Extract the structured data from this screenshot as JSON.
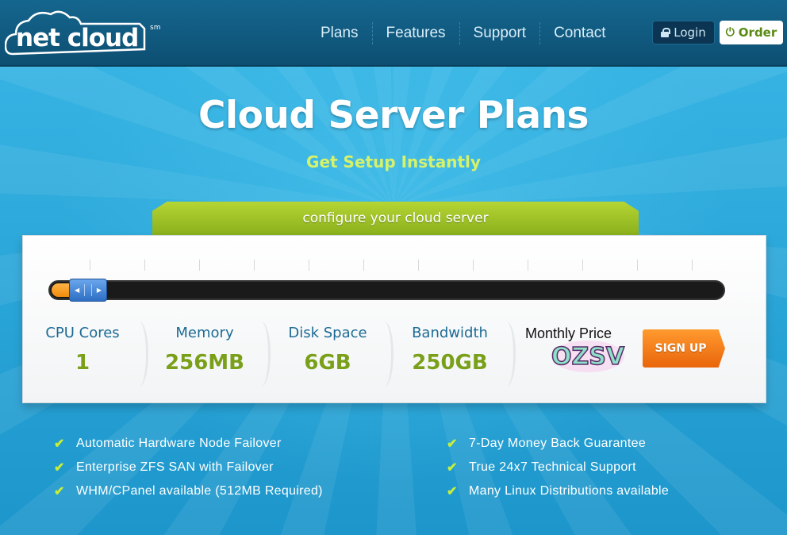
{
  "brand": {
    "logo_text": "net cloud",
    "logo_sm": "sm"
  },
  "nav": {
    "items": [
      "Plans",
      "Features",
      "Support",
      "Contact"
    ]
  },
  "header": {
    "login_label": "Login",
    "order_label": "Order"
  },
  "hero": {
    "title": "Cloud Server Plans",
    "subtitle": "Get Setup Instantly"
  },
  "configurator": {
    "tab_label": "configure your cloud server",
    "slider": {
      "level": 1,
      "steps": 12
    },
    "specs": [
      {
        "label": "CPU Cores",
        "value": "1"
      },
      {
        "label": "Memory",
        "value": "256MB"
      },
      {
        "label": "Disk Space",
        "value": "6GB"
      },
      {
        "label": "Bandwidth",
        "value": "250GB"
      }
    ],
    "price_label": "Monthly Price",
    "price_badge_text": "OZSV",
    "signup_label": "SIGN UP"
  },
  "features": {
    "left": [
      "Automatic Hardware Node Failover",
      "Enterprise ZFS SAN with Failover",
      "WHM/CPanel available (512MB Required)"
    ],
    "right": [
      "7-Day Money Back Guarantee",
      "True 24x7 Technical Support",
      "Many Linux Distributions available"
    ]
  },
  "colors": {
    "accent_green": "#8ab01c",
    "orange": "#f08c0c",
    "header_bg": "#0d4f72",
    "sky": "#2aa6d9"
  }
}
